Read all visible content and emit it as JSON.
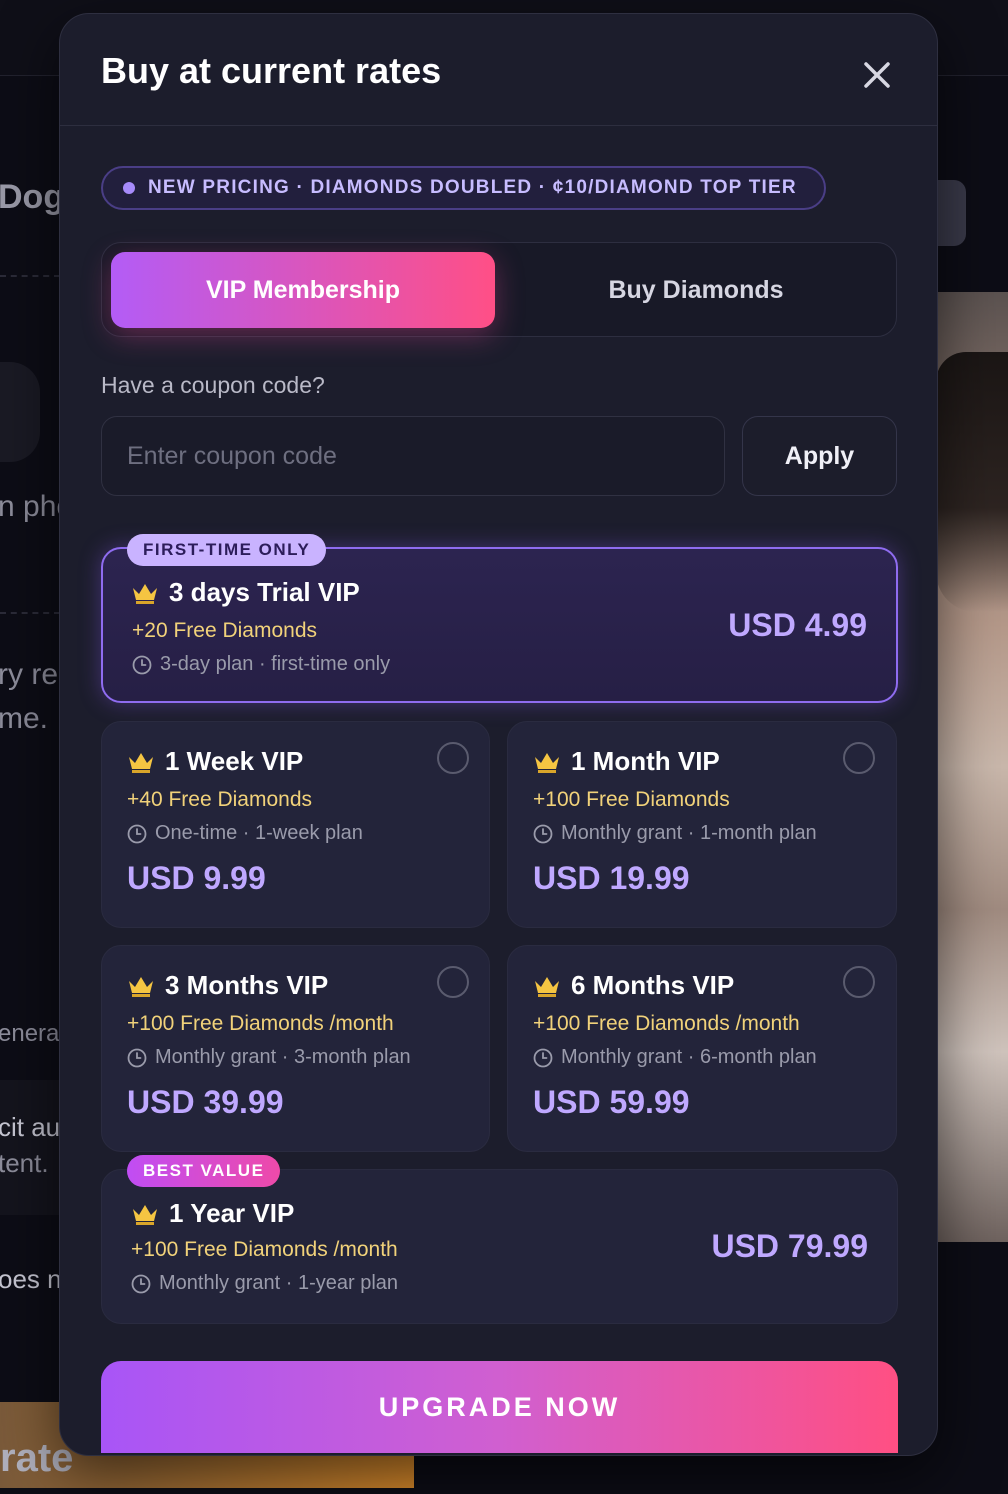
{
  "background": {
    "fragments": [
      "Dogg",
      "n pho",
      "ry re",
      "me.",
      "enera",
      "cit au",
      "tent.",
      "oes n",
      "rate"
    ]
  },
  "modal": {
    "title": "Buy at current rates",
    "notice": "NEW PRICING · DIAMONDS DOUBLED · ¢10/DIAMOND TOP TIER",
    "tabs": [
      {
        "label": "VIP Membership",
        "active": true
      },
      {
        "label": "Buy Diamonds",
        "active": false
      }
    ],
    "coupon": {
      "label": "Have a coupon code?",
      "placeholder": "Enter coupon code",
      "value": "",
      "apply_label": "Apply"
    },
    "plans": [
      {
        "badge": "FIRST-TIME ONLY",
        "name": "3 days Trial VIP",
        "bonus": "+20 Free Diamonds",
        "note": "3-day plan · first-time only",
        "price": "USD 4.99",
        "selected": true
      },
      {
        "name": "1 Week VIP",
        "bonus": "+40 Free Diamonds",
        "note": "One-time · 1-week plan",
        "price": "USD 9.99",
        "selected": false
      },
      {
        "name": "1 Month VIP",
        "bonus": "+100 Free Diamonds",
        "note": "Monthly grant · 1-month plan",
        "price": "USD 19.99",
        "selected": false
      },
      {
        "name": "3 Months VIP",
        "bonus": "+100 Free Diamonds /month",
        "note": "Monthly grant · 3-month plan",
        "price": "USD 39.99",
        "selected": false
      },
      {
        "name": "6 Months VIP",
        "bonus": "+100 Free Diamonds /month",
        "note": "Monthly grant · 6-month plan",
        "price": "USD 59.99",
        "selected": false
      },
      {
        "badge": "BEST VALUE",
        "name": "1 Year VIP",
        "bonus": "+100 Free Diamonds /month",
        "note": "Monthly grant · 1-year plan",
        "price": "USD 79.99",
        "selected": false
      }
    ],
    "cta": "UPGRADE NOW"
  },
  "icons": {
    "crown": "crown-icon",
    "clock": "clock-icon",
    "close": "close-icon"
  },
  "colors": {
    "modal_bg": "#1c1d2c",
    "accent_gradient_start": "#b35cf6",
    "accent_gradient_end": "#ff4f86",
    "price": "#bfa8ff",
    "bonus": "#f1d27a",
    "badge_first_time": "#c9b3ff"
  }
}
